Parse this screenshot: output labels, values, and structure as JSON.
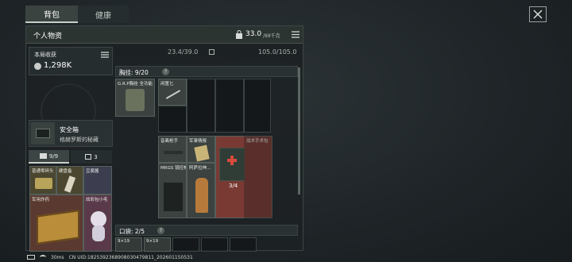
{
  "tabs": [
    {
      "label": "背包"
    },
    {
      "label": "健康"
    }
  ],
  "panel": {
    "title": "个人物资",
    "weight": "33.0",
    "weight_max": "/88千克"
  },
  "earnings": {
    "label": "本局收获",
    "value": "1,298K"
  },
  "top_bar": {
    "load_a": "23.4/39.0",
    "load_b": "105.0/105.0"
  },
  "chest_rig": {
    "label": "胸挂: 9/20",
    "help": "?"
  },
  "pockets": {
    "label": "口袋: 2/5",
    "help": "?"
  },
  "safe": {
    "name": "安全箱",
    "desc": "格赫罗斯的秘藏"
  },
  "safe_tabs": [
    {
      "count": "9/9"
    },
    {
      "count": "3"
    }
  ],
  "safe_items": [
    {
      "label": "普通零碎头"
    },
    {
      "label": "硬盘备"
    },
    {
      "label": "豆腐酱"
    },
    {
      "label": "军用炸药"
    },
    {
      "label": "炫彩包小毛"
    }
  ],
  "rig_items": [
    {
      "label": "G.R.P胸挂 全功能"
    },
    {
      "label": "闲置匕"
    }
  ],
  "grid_items": [
    {
      "label": "音离枪手"
    },
    {
      "label": "军事情报"
    },
    {
      "label": "战术手术包"
    },
    {
      "label": "MRGS 镜控枪托"
    },
    {
      "label": "阿萨拉神..."
    },
    {
      "label": "3/4"
    }
  ],
  "pocket_slots": [
    {
      "label": "9×19"
    },
    {
      "label": "9×19"
    }
  ],
  "footer": {
    "ping": "30ms",
    "uid": "CN UID:1825392368908030479811_202601150531"
  },
  "colors": {
    "accent": "#c7cfc9",
    "panel": "#1c2123",
    "slot_red": "#7a3a34",
    "slot_yellow": "#6a5a2c"
  }
}
